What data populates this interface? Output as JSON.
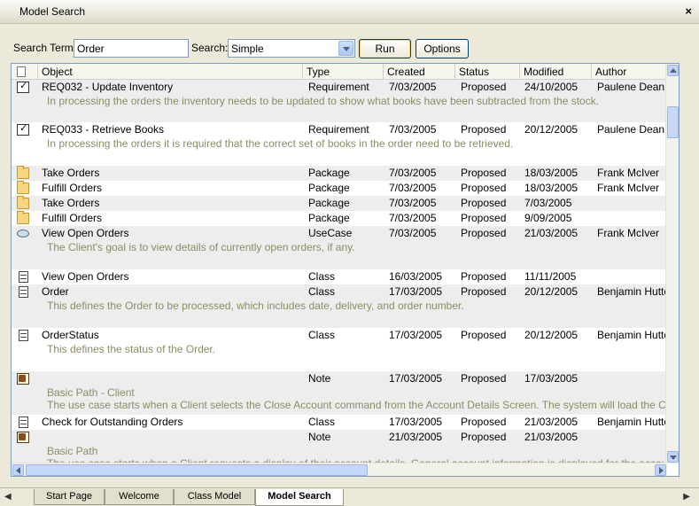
{
  "window": {
    "title": "Model Search",
    "close_label": "×"
  },
  "search": {
    "term_label": "Search Term:",
    "term_value": "Order",
    "mode_label": "Search:",
    "mode_value": "Simple",
    "run_label": "Run",
    "options_label": "Options"
  },
  "columns": [
    "Object",
    "Type",
    "Created",
    "Status",
    "Modified",
    "Author"
  ],
  "rows": [
    {
      "icon": "requirement-icon",
      "object": "REQ032 - Update Inventory",
      "type": "Requirement",
      "created": "7/03/2005",
      "status": "Proposed",
      "modified": "24/10/2005",
      "author": "Paulene Dean",
      "desc": "In processing the orders the inventory needs to be updated to show what books have been subtracted from the stock."
    },
    {
      "icon": "requirement-icon",
      "object": "REQ033 - Retrieve Books",
      "type": "Requirement",
      "created": "7/03/2005",
      "status": "Proposed",
      "modified": "20/12/2005",
      "author": "Paulene Dean",
      "desc": "In processing the orders it is required that the correct set of books in the order need to be retrieved."
    },
    {
      "icon": "package-icon",
      "object": "Take Orders",
      "type": "Package",
      "created": "7/03/2005",
      "status": "Proposed",
      "modified": "18/03/2005",
      "author": "Frank McIver"
    },
    {
      "icon": "package-icon",
      "object": "Fulfill Orders",
      "type": "Package",
      "created": "7/03/2005",
      "status": "Proposed",
      "modified": "18/03/2005",
      "author": "Frank McIver"
    },
    {
      "icon": "package-icon",
      "object": "Take Orders",
      "type": "Package",
      "created": "7/03/2005",
      "status": "Proposed",
      "modified": "7/03/2005",
      "author": ""
    },
    {
      "icon": "package-icon",
      "object": "Fulfill Orders",
      "type": "Package",
      "created": "7/03/2005",
      "status": "Proposed",
      "modified": "9/09/2005",
      "author": ""
    },
    {
      "icon": "usecase-icon",
      "object": "View Open Orders",
      "type": "UseCase",
      "created": "7/03/2005",
      "status": "Proposed",
      "modified": "21/03/2005",
      "author": "Frank McIver",
      "desc": "The Client's goal is to view details of currently open orders, if any."
    },
    {
      "icon": "class-icon",
      "object": "View Open Orders",
      "type": "Class",
      "created": "16/03/2005",
      "status": "Proposed",
      "modified": "11/11/2005",
      "author": ""
    },
    {
      "icon": "class-icon",
      "object": "Order",
      "type": "Class",
      "created": "17/03/2005",
      "status": "Proposed",
      "modified": "20/12/2005",
      "author": "Benjamin Hutton",
      "desc": "This defines the Order to be processed, which includes date, delivery, and order number."
    },
    {
      "icon": "class-icon",
      "object": "OrderStatus",
      "type": "Class",
      "created": "17/03/2005",
      "status": "Proposed",
      "modified": "20/12/2005",
      "author": "Benjamin Hutton",
      "desc": "This defines the status of the Order."
    },
    {
      "icon": "note-icon",
      "object": "",
      "type": "Note",
      "created": "17/03/2005",
      "status": "Proposed",
      "modified": "17/03/2005",
      "author": "",
      "sub": "Basic Path - Client",
      "desc": "The use case starts when a Client selects the Close Account command from the Account Details Screen. The system will load the Client's account details"
    },
    {
      "icon": "class-icon",
      "object": "Check for Outstanding Orders",
      "type": "Class",
      "created": "17/03/2005",
      "status": "Proposed",
      "modified": "21/03/2005",
      "author": "Benjamin Hutton"
    },
    {
      "icon": "note-icon",
      "object": "",
      "type": "Note",
      "created": "21/03/2005",
      "status": "Proposed",
      "modified": "21/03/2005",
      "author": "",
      "sub": "Basic Path",
      "desc": "The use case starts when a Client requests a display of their account details. General account information is displayed for the account holder"
    }
  ],
  "tabs": [
    "Start Page",
    "Welcome",
    "Class Model",
    "Model Search"
  ],
  "active_tab": "Model Search"
}
